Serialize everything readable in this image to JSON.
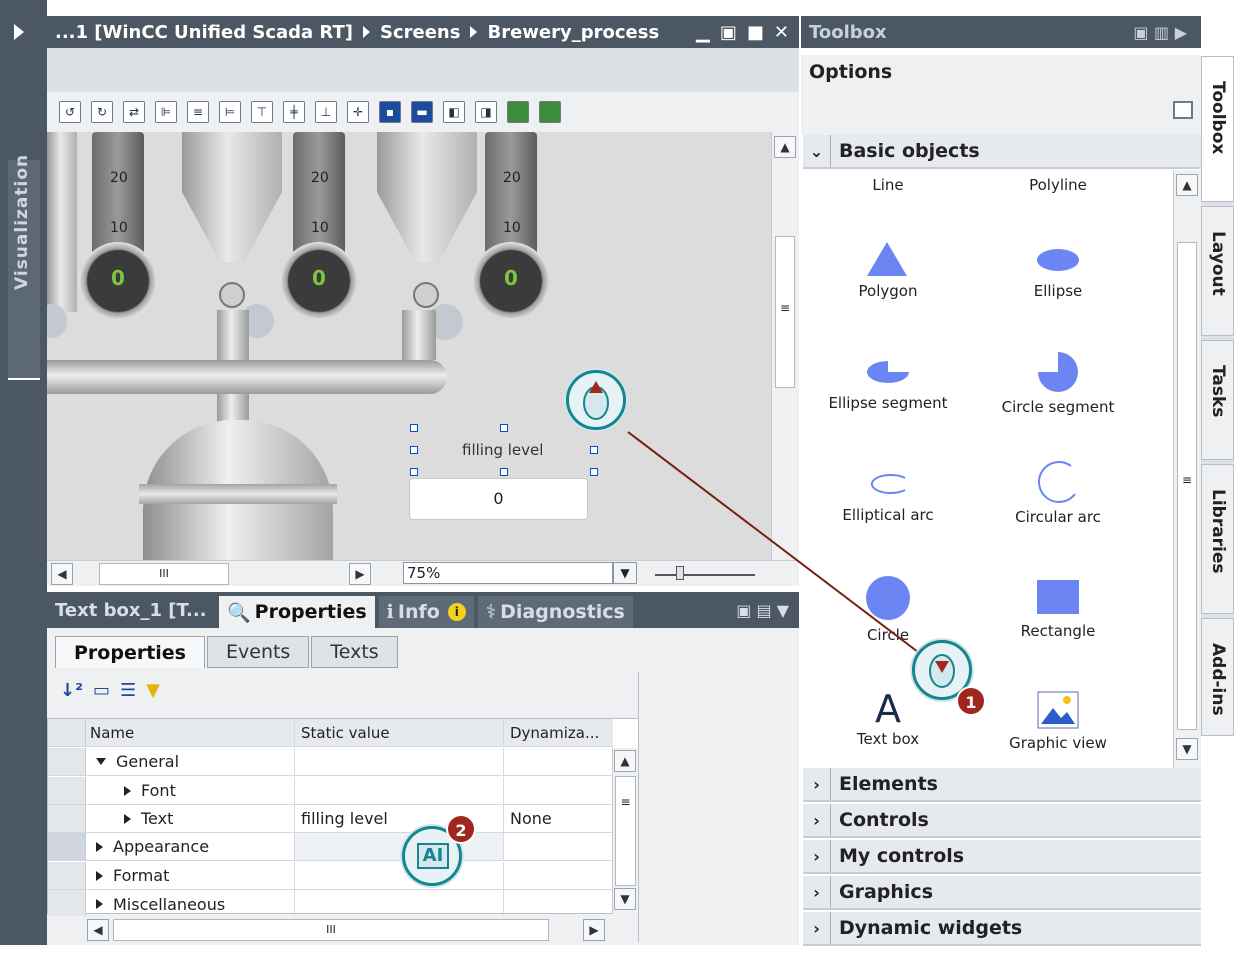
{
  "editor": {
    "title_parts": [
      "...1 [WinCC Unified Scada RT]",
      "Screens",
      "Brewery_process"
    ],
    "window_buttons": [
      "▁",
      "▣",
      "■",
      "✕"
    ]
  },
  "sidebar": {
    "label": "Visualization"
  },
  "canvas": {
    "gauge_ticks": [
      "20",
      "10"
    ],
    "dial_values": [
      "0",
      "0",
      "0"
    ],
    "filling_level_label": "filling level",
    "filling_level_value": "0"
  },
  "zoom": {
    "value": "75%"
  },
  "bottom_panel": {
    "title": "Text box_1 [T...",
    "tabs": [
      {
        "label": "Properties"
      },
      {
        "label": "Info"
      },
      {
        "label": "Diagnostics"
      }
    ],
    "subtabs": [
      "Properties",
      "Events",
      "Texts"
    ],
    "table": {
      "headers": [
        "Name",
        "Static value",
        "Dynamiza..."
      ],
      "rows": [
        {
          "name": "General",
          "value": "",
          "dyn": ""
        },
        {
          "name": "Font",
          "value": "",
          "dyn": ""
        },
        {
          "name": "Text",
          "value": "filling level",
          "dyn": "None"
        },
        {
          "name": "Appearance",
          "value": "",
          "dyn": ""
        },
        {
          "name": "Format",
          "value": "",
          "dyn": ""
        },
        {
          "name": "Miscellaneous",
          "value": "",
          "dyn": ""
        }
      ]
    }
  },
  "toolbox": {
    "title": "Toolbox",
    "options_label": "Options",
    "basic_objects": "Basic objects",
    "objects": [
      "Line",
      "Polyline",
      "Polygon",
      "Ellipse",
      "Ellipse segment",
      "Circle segment",
      "Elliptical arc",
      "Circular arc",
      "Circle",
      "Rectangle",
      "Text box",
      "Graphic view"
    ],
    "categories": [
      "Elements",
      "Controls",
      "My controls",
      "Graphics",
      "Dynamic widgets"
    ]
  },
  "right_tabs": [
    "Toolbox",
    "Layout",
    "Tasks",
    "Libraries",
    "Add-ins"
  ],
  "callouts": {
    "step1": "1",
    "step2": "2"
  },
  "colors": {
    "header": "#4c5764",
    "accent": "#16858f",
    "marker": "#a0271d",
    "dial_text": "#7ec63c"
  }
}
